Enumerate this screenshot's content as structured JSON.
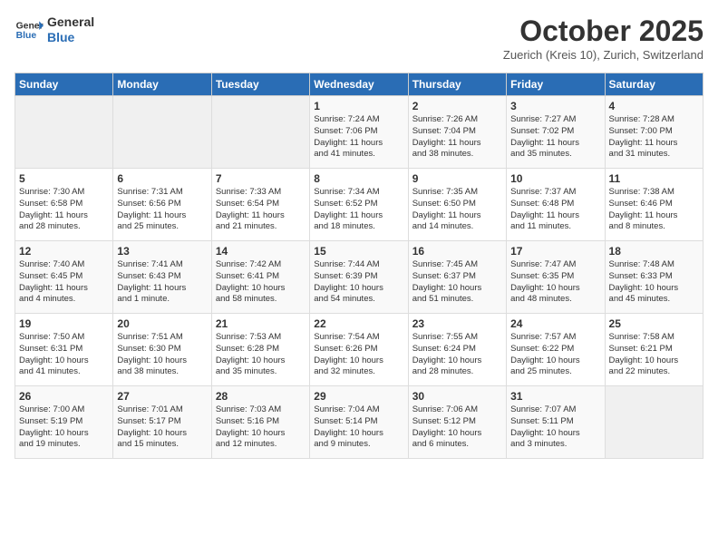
{
  "header": {
    "logo_line1": "General",
    "logo_line2": "Blue",
    "month": "October 2025",
    "location": "Zuerich (Kreis 10), Zurich, Switzerland"
  },
  "days_of_week": [
    "Sunday",
    "Monday",
    "Tuesday",
    "Wednesday",
    "Thursday",
    "Friday",
    "Saturday"
  ],
  "weeks": [
    [
      {
        "day": "",
        "info": ""
      },
      {
        "day": "",
        "info": ""
      },
      {
        "day": "",
        "info": ""
      },
      {
        "day": "1",
        "info": "Sunrise: 7:24 AM\nSunset: 7:06 PM\nDaylight: 11 hours\nand 41 minutes."
      },
      {
        "day": "2",
        "info": "Sunrise: 7:26 AM\nSunset: 7:04 PM\nDaylight: 11 hours\nand 38 minutes."
      },
      {
        "day": "3",
        "info": "Sunrise: 7:27 AM\nSunset: 7:02 PM\nDaylight: 11 hours\nand 35 minutes."
      },
      {
        "day": "4",
        "info": "Sunrise: 7:28 AM\nSunset: 7:00 PM\nDaylight: 11 hours\nand 31 minutes."
      }
    ],
    [
      {
        "day": "5",
        "info": "Sunrise: 7:30 AM\nSunset: 6:58 PM\nDaylight: 11 hours\nand 28 minutes."
      },
      {
        "day": "6",
        "info": "Sunrise: 7:31 AM\nSunset: 6:56 PM\nDaylight: 11 hours\nand 25 minutes."
      },
      {
        "day": "7",
        "info": "Sunrise: 7:33 AM\nSunset: 6:54 PM\nDaylight: 11 hours\nand 21 minutes."
      },
      {
        "day": "8",
        "info": "Sunrise: 7:34 AM\nSunset: 6:52 PM\nDaylight: 11 hours\nand 18 minutes."
      },
      {
        "day": "9",
        "info": "Sunrise: 7:35 AM\nSunset: 6:50 PM\nDaylight: 11 hours\nand 14 minutes."
      },
      {
        "day": "10",
        "info": "Sunrise: 7:37 AM\nSunset: 6:48 PM\nDaylight: 11 hours\nand 11 minutes."
      },
      {
        "day": "11",
        "info": "Sunrise: 7:38 AM\nSunset: 6:46 PM\nDaylight: 11 hours\nand 8 minutes."
      }
    ],
    [
      {
        "day": "12",
        "info": "Sunrise: 7:40 AM\nSunset: 6:45 PM\nDaylight: 11 hours\nand 4 minutes."
      },
      {
        "day": "13",
        "info": "Sunrise: 7:41 AM\nSunset: 6:43 PM\nDaylight: 11 hours\nand 1 minute."
      },
      {
        "day": "14",
        "info": "Sunrise: 7:42 AM\nSunset: 6:41 PM\nDaylight: 10 hours\nand 58 minutes."
      },
      {
        "day": "15",
        "info": "Sunrise: 7:44 AM\nSunset: 6:39 PM\nDaylight: 10 hours\nand 54 minutes."
      },
      {
        "day": "16",
        "info": "Sunrise: 7:45 AM\nSunset: 6:37 PM\nDaylight: 10 hours\nand 51 minutes."
      },
      {
        "day": "17",
        "info": "Sunrise: 7:47 AM\nSunset: 6:35 PM\nDaylight: 10 hours\nand 48 minutes."
      },
      {
        "day": "18",
        "info": "Sunrise: 7:48 AM\nSunset: 6:33 PM\nDaylight: 10 hours\nand 45 minutes."
      }
    ],
    [
      {
        "day": "19",
        "info": "Sunrise: 7:50 AM\nSunset: 6:31 PM\nDaylight: 10 hours\nand 41 minutes."
      },
      {
        "day": "20",
        "info": "Sunrise: 7:51 AM\nSunset: 6:30 PM\nDaylight: 10 hours\nand 38 minutes."
      },
      {
        "day": "21",
        "info": "Sunrise: 7:53 AM\nSunset: 6:28 PM\nDaylight: 10 hours\nand 35 minutes."
      },
      {
        "day": "22",
        "info": "Sunrise: 7:54 AM\nSunset: 6:26 PM\nDaylight: 10 hours\nand 32 minutes."
      },
      {
        "day": "23",
        "info": "Sunrise: 7:55 AM\nSunset: 6:24 PM\nDaylight: 10 hours\nand 28 minutes."
      },
      {
        "day": "24",
        "info": "Sunrise: 7:57 AM\nSunset: 6:22 PM\nDaylight: 10 hours\nand 25 minutes."
      },
      {
        "day": "25",
        "info": "Sunrise: 7:58 AM\nSunset: 6:21 PM\nDaylight: 10 hours\nand 22 minutes."
      }
    ],
    [
      {
        "day": "26",
        "info": "Sunrise: 7:00 AM\nSunset: 5:19 PM\nDaylight: 10 hours\nand 19 minutes."
      },
      {
        "day": "27",
        "info": "Sunrise: 7:01 AM\nSunset: 5:17 PM\nDaylight: 10 hours\nand 15 minutes."
      },
      {
        "day": "28",
        "info": "Sunrise: 7:03 AM\nSunset: 5:16 PM\nDaylight: 10 hours\nand 12 minutes."
      },
      {
        "day": "29",
        "info": "Sunrise: 7:04 AM\nSunset: 5:14 PM\nDaylight: 10 hours\nand 9 minutes."
      },
      {
        "day": "30",
        "info": "Sunrise: 7:06 AM\nSunset: 5:12 PM\nDaylight: 10 hours\nand 6 minutes."
      },
      {
        "day": "31",
        "info": "Sunrise: 7:07 AM\nSunset: 5:11 PM\nDaylight: 10 hours\nand 3 minutes."
      },
      {
        "day": "",
        "info": ""
      }
    ]
  ]
}
